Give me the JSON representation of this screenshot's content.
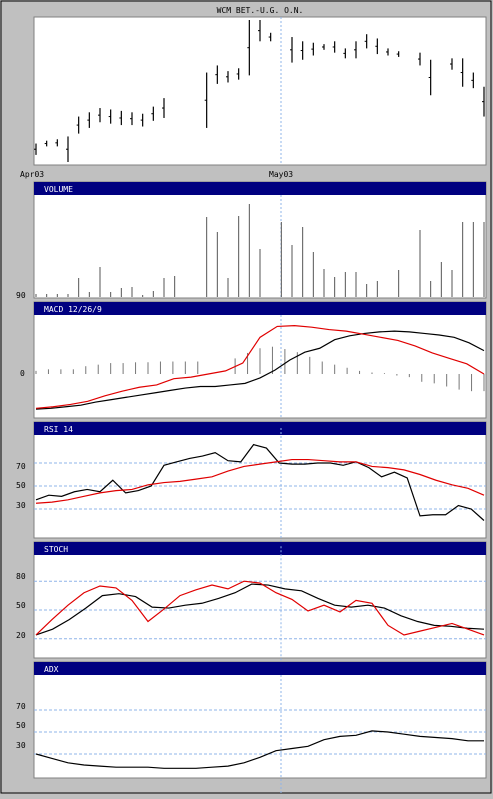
{
  "title": "WCM BET.-U.G. O.N.",
  "date_labels": [
    "Apr03",
    "May03"
  ],
  "colors": {
    "background": "#c0c0c0",
    "panel": "#ffffff",
    "header": "#000080",
    "header_text": "#ffffff",
    "line_black": "#000000",
    "line_red": "#e00000",
    "grid": "#8fb4e8",
    "bar": "#555555"
  },
  "chart_data": [
    {
      "type": "ohlc",
      "panel": "price",
      "title": "WCM BET.-U.G. O.N.",
      "x_labels": [
        "Apr03",
        "May03"
      ],
      "bars": [
        {
          "x": 0,
          "high": 0.13,
          "low": 0.05
        },
        {
          "x": 1,
          "high": 0.15,
          "low": 0.11
        },
        {
          "x": 2,
          "high": 0.16,
          "low": 0.11
        },
        {
          "x": 3,
          "high": 0.18,
          "low": 0.0
        },
        {
          "x": 4,
          "high": 0.32,
          "low": 0.2
        },
        {
          "x": 5,
          "high": 0.35,
          "low": 0.24
        },
        {
          "x": 6,
          "high": 0.38,
          "low": 0.28
        },
        {
          "x": 7,
          "high": 0.37,
          "low": 0.27
        },
        {
          "x": 8,
          "high": 0.36,
          "low": 0.26
        },
        {
          "x": 9,
          "high": 0.35,
          "low": 0.26
        },
        {
          "x": 10,
          "high": 0.34,
          "low": 0.25
        },
        {
          "x": 11,
          "high": 0.39,
          "low": 0.29
        },
        {
          "x": 12,
          "high": 0.45,
          "low": 0.31
        },
        {
          "x": 16,
          "high": 0.63,
          "low": 0.24
        },
        {
          "x": 17,
          "high": 0.68,
          "low": 0.55
        },
        {
          "x": 18,
          "high": 0.64,
          "low": 0.56
        },
        {
          "x": 19,
          "high": 0.66,
          "low": 0.58
        },
        {
          "x": 20,
          "high": 1.0,
          "low": 0.61
        },
        {
          "x": 21,
          "high": 1.0,
          "low": 0.85
        },
        {
          "x": 22,
          "high": 0.91,
          "low": 0.85
        },
        {
          "x": 24,
          "high": 0.88,
          "low": 0.7
        },
        {
          "x": 25,
          "high": 0.85,
          "low": 0.72
        },
        {
          "x": 26,
          "high": 0.84,
          "low": 0.75
        },
        {
          "x": 27,
          "high": 0.83,
          "low": 0.79
        },
        {
          "x": 28,
          "high": 0.85,
          "low": 0.77
        },
        {
          "x": 29,
          "high": 0.8,
          "low": 0.73
        },
        {
          "x": 30,
          "high": 0.85,
          "low": 0.73
        },
        {
          "x": 31,
          "high": 0.9,
          "low": 0.8
        },
        {
          "x": 32,
          "high": 0.87,
          "low": 0.76
        },
        {
          "x": 33,
          "high": 0.8,
          "low": 0.75
        },
        {
          "x": 34,
          "high": 0.78,
          "low": 0.74
        },
        {
          "x": 36,
          "high": 0.77,
          "low": 0.68
        },
        {
          "x": 37,
          "high": 0.72,
          "low": 0.47
        },
        {
          "x": 39,
          "high": 0.73,
          "low": 0.65
        },
        {
          "x": 40,
          "high": 0.73,
          "low": 0.53
        },
        {
          "x": 41,
          "high": 0.63,
          "low": 0.52
        },
        {
          "x": 42,
          "high": 0.53,
          "low": 0.32
        }
      ]
    },
    {
      "type": "bar",
      "panel": "volume",
      "title": "VOLUME",
      "y_tick": "90",
      "values": [
        0.03,
        0.03,
        0.03,
        0.03,
        0.19,
        0.05,
        0.3,
        0.05,
        0.09,
        0.1,
        0.02,
        0.06,
        0.19,
        0.21,
        0,
        0,
        0.8,
        0.65,
        0.19,
        0.81,
        0.93,
        0.48,
        0,
        0.75,
        0.52,
        0.7,
        0.45,
        0.28,
        0.2,
        0.25,
        0.25,
        0.13,
        0.16,
        0,
        0.27,
        0,
        0.67,
        0.16,
        0.35,
        0.27,
        0.75,
        0.75,
        0.75
      ]
    },
    {
      "type": "line",
      "panel": "macd",
      "title": "MACD 12/26/9",
      "y_tick": "0",
      "series": [
        {
          "color": "black",
          "values": [
            -0.45,
            -0.44,
            -0.42,
            -0.4,
            -0.36,
            -0.33,
            -0.3,
            -0.27,
            -0.24,
            -0.21,
            -0.18,
            -0.16,
            -0.16,
            -0.14,
            -0.12,
            -0.05,
            0.05,
            0.18,
            0.28,
            0.33,
            0.44,
            0.49,
            0.52,
            0.54,
            0.55,
            0.54,
            0.52,
            0.5,
            0.47,
            0.4,
            0.3
          ]
        },
        {
          "color": "red",
          "values": [
            -0.44,
            -0.42,
            -0.39,
            -0.35,
            -0.28,
            -0.22,
            -0.17,
            -0.14,
            -0.06,
            -0.04,
            0.0,
            0.04,
            0.14,
            0.47,
            0.61,
            0.62,
            0.6,
            0.57,
            0.55,
            0.51,
            0.47,
            0.43,
            0.36,
            0.27,
            0.2,
            0.13,
            0.0
          ]
        },
        {
          "color": "bar",
          "histogram": [
            0.04,
            0.06,
            0.06,
            0.06,
            0.1,
            0.12,
            0.14,
            0.14,
            0.15,
            0.15,
            0.16,
            0.16,
            0.16,
            0.16,
            0,
            0,
            0.2,
            0.27,
            0.33,
            0.35,
            0.32,
            0.28,
            0.22,
            0.16,
            0.12,
            0.08,
            0.04,
            0.02,
            0.01,
            -0.02,
            -0.04,
            -0.1,
            -0.12,
            -0.16,
            -0.2,
            -0.22,
            -0.22
          ]
        }
      ]
    },
    {
      "type": "line",
      "panel": "rsi",
      "title": "RSI 14",
      "y_ticks": [
        70,
        50,
        30
      ],
      "ylim": [
        10,
        90
      ],
      "series": [
        {
          "color": "black",
          "values": [
            38,
            42,
            41,
            45,
            47,
            45,
            55,
            44,
            46,
            50,
            68,
            71,
            74,
            76,
            79,
            72,
            71,
            86,
            83,
            70,
            69,
            69,
            70,
            70,
            68,
            71,
            66,
            58,
            62,
            57,
            24,
            25,
            25,
            33,
            30,
            20
          ]
        },
        {
          "color": "red",
          "values": [
            35,
            36,
            38,
            41,
            44,
            46,
            47,
            51,
            53,
            54,
            56,
            58,
            63,
            67,
            69,
            71,
            73,
            73,
            72,
            71,
            71,
            67,
            66,
            64,
            60,
            55,
            51,
            48,
            42
          ]
        }
      ]
    },
    {
      "type": "line",
      "panel": "stoch",
      "title": "STOCH",
      "y_ticks": [
        80,
        50,
        20
      ],
      "ylim": [
        0,
        100
      ],
      "series": [
        {
          "color": "black",
          "values": [
            24,
            30,
            40,
            52,
            65,
            67,
            64,
            53,
            52,
            55,
            57,
            62,
            68,
            77,
            76,
            72,
            70,
            62,
            55,
            53,
            55,
            52,
            44,
            38,
            34,
            33,
            31,
            30
          ]
        },
        {
          "color": "red",
          "values": [
            24,
            40,
            55,
            68,
            75,
            73,
            60,
            38,
            51,
            65,
            71,
            76,
            72,
            80,
            78,
            68,
            61,
            49,
            55,
            48,
            60,
            57,
            34,
            24,
            28,
            32,
            36,
            30,
            24
          ]
        }
      ]
    },
    {
      "type": "line",
      "panel": "adx",
      "title": "ADX",
      "y_ticks": [
        70,
        50,
        30
      ],
      "ylim": [
        0,
        100
      ],
      "series": [
        {
          "color": "black",
          "values": [
            30,
            26,
            22,
            20,
            19,
            18,
            18,
            18,
            17,
            17,
            17,
            18,
            19,
            22,
            27,
            33,
            35,
            37,
            43,
            46,
            47,
            51,
            50,
            48,
            46,
            45,
            44,
            42,
            42
          ]
        }
      ]
    }
  ]
}
